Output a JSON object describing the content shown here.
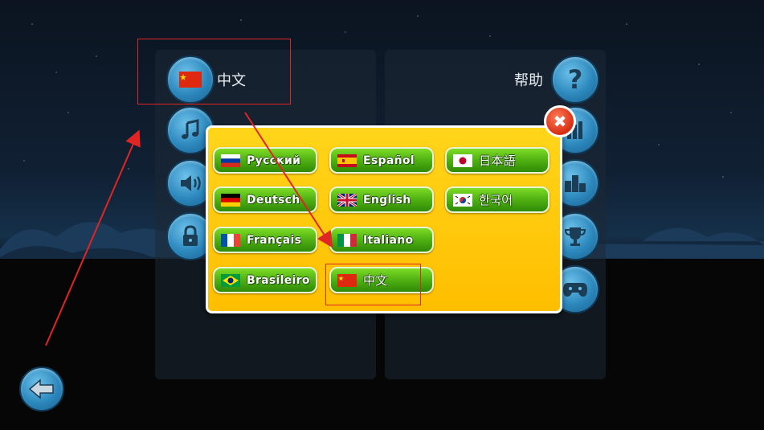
{
  "left_menu": {
    "current_language": "中文",
    "items": [
      {
        "icon": "china-flag-icon"
      },
      {
        "icon": "music-note-icon"
      },
      {
        "icon": "speaker-icon"
      },
      {
        "icon": "lock-icon"
      }
    ]
  },
  "right_menu": {
    "help_label": "帮助",
    "icons": [
      "question-mark-icon",
      "chart-icon",
      "leaderboard-icon",
      "trophy-icon",
      "controller-icon"
    ]
  },
  "language_dialog": {
    "languages": [
      {
        "label": "Русский",
        "flag": "russia"
      },
      {
        "label": "Español",
        "flag": "spain"
      },
      {
        "label": "日本語",
        "flag": "japan"
      },
      {
        "label": "Deutsch",
        "flag": "germany"
      },
      {
        "label": "English",
        "flag": "uk"
      },
      {
        "label": "한국어",
        "flag": "korea"
      },
      {
        "label": "Français",
        "flag": "france"
      },
      {
        "label": "Italiano",
        "flag": "italy"
      },
      {
        "label": "Brasileiro",
        "flag": "brazil"
      },
      {
        "label": "中文",
        "flag": "china"
      }
    ],
    "close_icon": "close-icon"
  },
  "back_button": {
    "icon": "back-arrow-icon"
  },
  "colors": {
    "annotation": "#e02525",
    "dialog_yellow": "#ffc80a",
    "button_green": "#4fb012",
    "round_blue": "#2c88bd"
  }
}
